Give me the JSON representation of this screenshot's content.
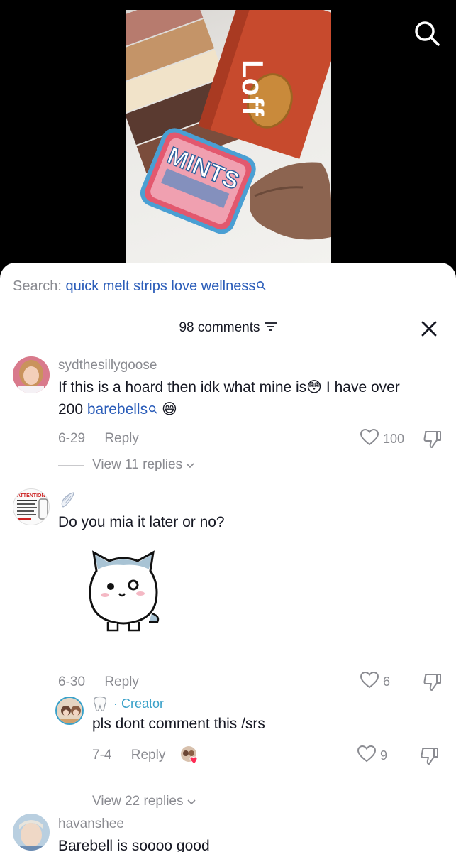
{
  "search": {
    "prefix": "Search:",
    "query": "quick melt strips love wellness"
  },
  "header": {
    "comment_count": "98 comments"
  },
  "video": {
    "package_text_1": "Loff",
    "package_text_2": "MINTS"
  },
  "comments": [
    {
      "username": "sydthesillygoose",
      "text_line1": "If this is a hoard then idk what mine is",
      "text_line1_end": " I have over",
      "text_line2_prefix": "200 ",
      "mention": "barebells",
      "emoji_1": "😳",
      "emoji_2": "😅",
      "date": "6-29",
      "reply_label": "Reply",
      "likes": "100",
      "view_replies": "View 11 replies"
    },
    {
      "username_icon": "angel-wing-icon",
      "text": "Do you mia it later or no?",
      "avatar_text": "ATTENTION",
      "date": "6-30",
      "reply_label": "Reply",
      "likes": "6",
      "view_replies": "View 22 replies",
      "reply": {
        "username_icon": "tooth-icon",
        "creator_label": "· Creator",
        "text": "pls dont comment this /srs",
        "date": "7-4",
        "reply_label": "Reply",
        "likes": "9"
      }
    },
    {
      "username": "havanshee",
      "text": "Barebell is soooo good"
    }
  ],
  "colors": {
    "link": "#2b5db9",
    "muted": "#8a8b91",
    "creator": "#3aa1c9",
    "text": "#161823"
  }
}
